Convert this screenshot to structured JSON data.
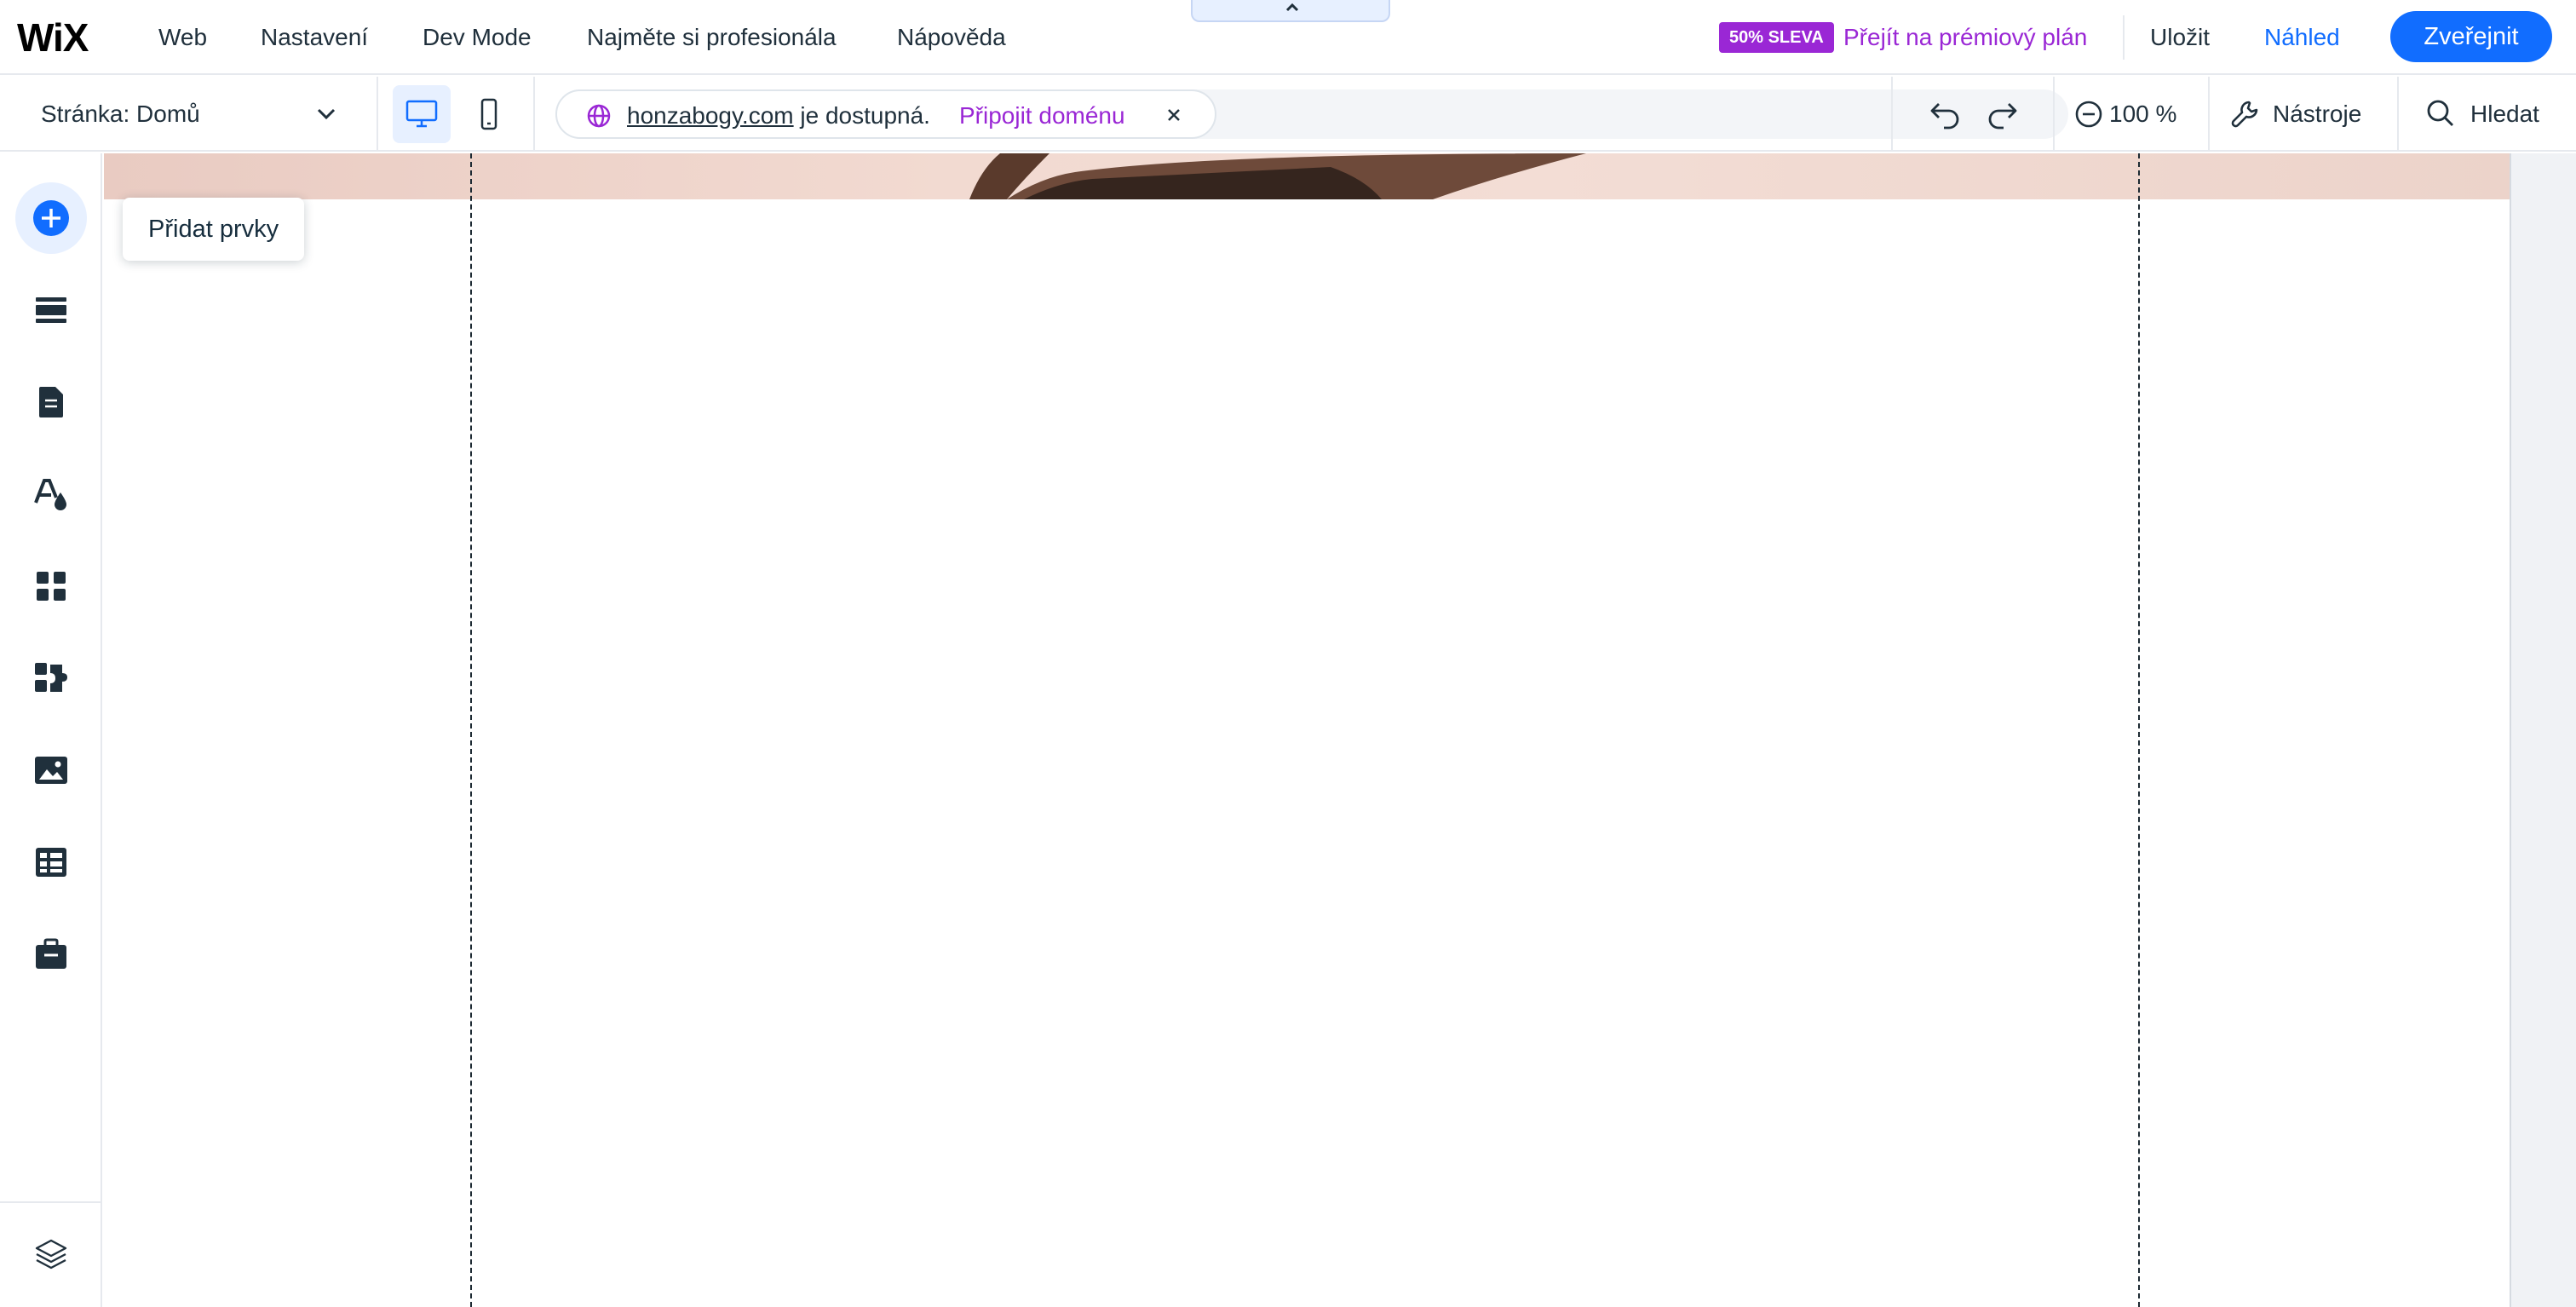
{
  "app": {
    "logo_text": "WiX",
    "menu": [
      "Web",
      "Nastavení",
      "Dev Mode",
      "Najměte si profesionála",
      "Nápověda"
    ]
  },
  "promo": {
    "badge": "50% SLEVA",
    "link": "Přejít na prémiový plán"
  },
  "actions": {
    "save": "Uložit",
    "preview": "Náhled",
    "publish": "Zveřejnit"
  },
  "subbar": {
    "page_label": "Stránka: Domů",
    "domain_name": "honzabogy.com",
    "domain_status": "je dostupná.",
    "domain_connect": "Připojit doménu",
    "zoom": "100 %",
    "tools": "Nástroje",
    "search": "Hledat"
  },
  "leftbar": {
    "items": [
      {
        "name": "add-elements",
        "icon": "plus-circle-icon"
      },
      {
        "name": "sections",
        "icon": "sections-icon"
      },
      {
        "name": "pages",
        "icon": "page-icon"
      },
      {
        "name": "design",
        "icon": "theme-icon"
      },
      {
        "name": "apps",
        "icon": "apps-icon"
      },
      {
        "name": "business-apps",
        "icon": "puzzle-icon"
      },
      {
        "name": "media",
        "icon": "image-icon"
      },
      {
        "name": "cms",
        "icon": "table-icon"
      },
      {
        "name": "portfolio",
        "icon": "briefcase-icon"
      }
    ],
    "layers_icon": "layers-icon",
    "tooltip": "Přidat prvky"
  },
  "colors": {
    "accent": "#116dff",
    "premium": "#9a27d5",
    "text": "#20303c",
    "hero": "#ecd3ca"
  }
}
